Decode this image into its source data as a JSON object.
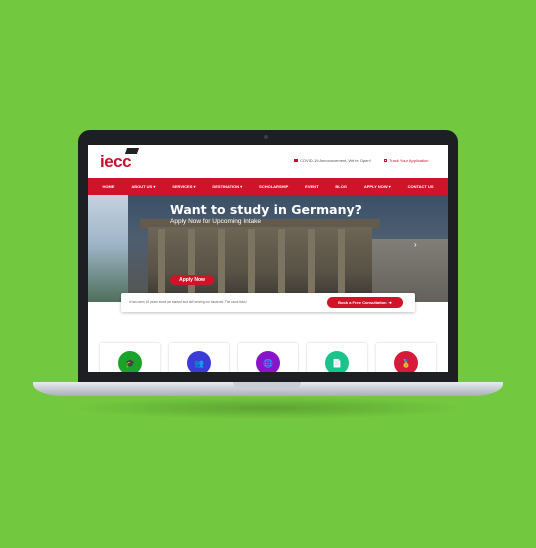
{
  "site": {
    "logo": "iecc",
    "notice": "COVID-19 Announcement, We're Open!",
    "track": "Track Your Application"
  },
  "nav": [
    "HOME",
    "ABOUT US ▾",
    "SERVICES ▾",
    "DESTINATION ▾",
    "SCHOLARSHIP",
    "EVENT",
    "BLOG",
    "APPLY NOW ▾",
    "CONTACT US"
  ],
  "hero": {
    "title": "Want to study in Germany?",
    "subtitle": "Apply Now for Upcoming Intake",
    "cta": "Apply Now",
    "next_arrow": "›"
  },
  "consult": {
    "text": "It has been 16 years since we started and still serving our students. The clock ticks!",
    "button": "Book a Free Consultation"
  },
  "cards": [
    {
      "color": "#1aa32a",
      "icon": "graduation-icon"
    },
    {
      "color": "#3b3bd6",
      "icon": "users-icon"
    },
    {
      "color": "#8a14c9",
      "icon": "globe-icon"
    },
    {
      "color": "#18c48a",
      "icon": "document-icon"
    },
    {
      "color": "#d71a3a",
      "icon": "award-icon"
    }
  ]
}
